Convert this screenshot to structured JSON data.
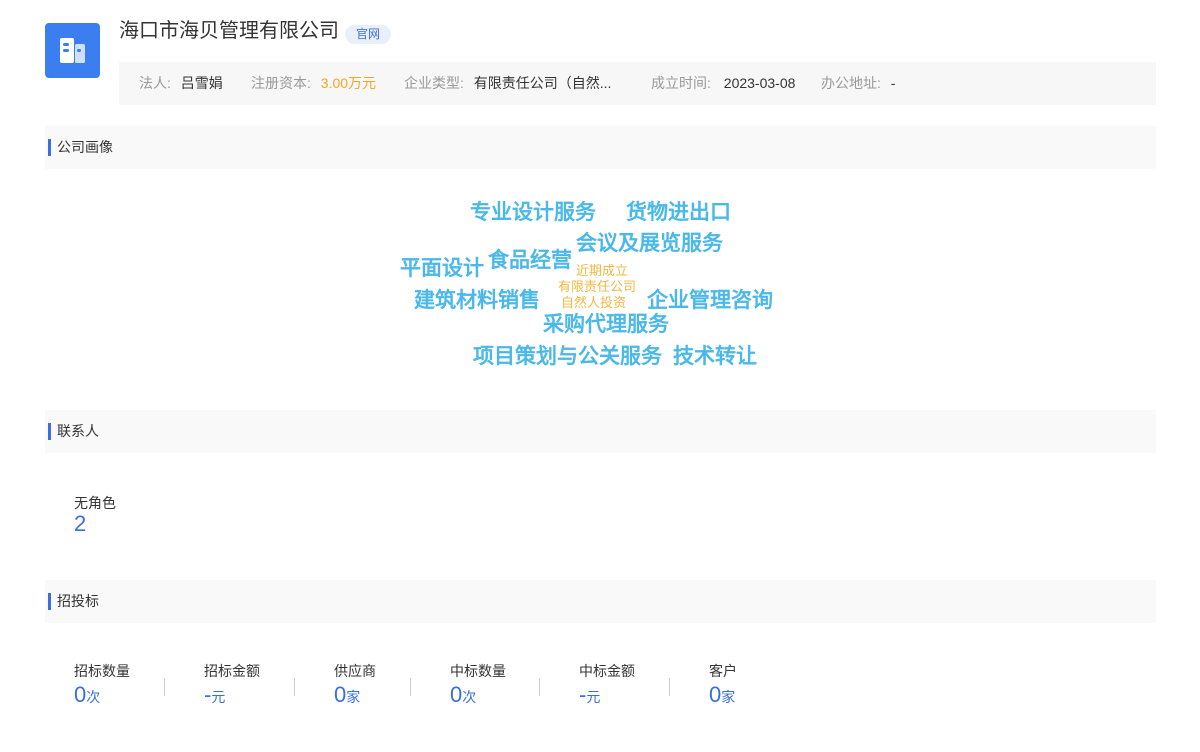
{
  "company": {
    "name": "海口市海贝管理有限公司",
    "site_badge": "官网"
  },
  "info": {
    "legal_label": "法人:",
    "legal_value": "吕雪娟",
    "capital_label": "注册资本:",
    "capital_value": "3.00万元",
    "type_label": "企业类型:",
    "type_value": "有限责任公司（自然...",
    "founded_label": "成立时间:",
    "founded_value": "2023-03-08",
    "address_label": "办公地址:",
    "address_value": "-"
  },
  "sections": {
    "portrait": "公司画像",
    "contacts": "联系人",
    "bidding": "招投标"
  },
  "word_cloud": [
    "专业设计服务",
    "货物进出口",
    "会议及展览服务",
    "平面设计",
    "食品经营",
    "近期成立",
    "有限责任公司",
    "自然人投资",
    "建筑材料销售",
    "企业管理咨询",
    "采购代理服务",
    "项目策划与公关服务",
    "技术转让"
  ],
  "contacts": {
    "role_label": "无角色",
    "role_count": "2"
  },
  "bidding_stats": [
    {
      "label": "招标数量",
      "value": "0",
      "unit": "次"
    },
    {
      "label": "招标金额",
      "value": "-",
      "unit": "元"
    },
    {
      "label": "供应商",
      "value": "0",
      "unit": "家"
    },
    {
      "label": "中标数量",
      "value": "0",
      "unit": "次"
    },
    {
      "label": "中标金额",
      "value": "-",
      "unit": "元"
    },
    {
      "label": "客户",
      "value": "0",
      "unit": "家"
    }
  ],
  "colors": {
    "accent": "#3a6ee0",
    "logo": "#3a7ef0",
    "capital": "#f5a623",
    "cloud_primary": "#4ab8e8",
    "cloud_secondary": "#f0b840"
  },
  "icons": {
    "logo": "building-icon"
  }
}
